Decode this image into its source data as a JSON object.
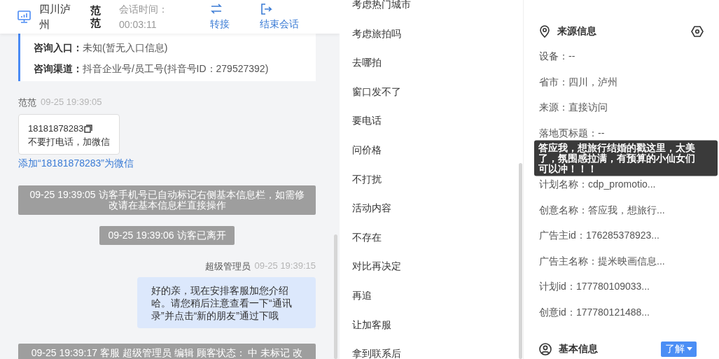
{
  "header": {
    "location": "四川泸州",
    "agent": "范范",
    "duration_label": "会话时间：",
    "duration": "00:03:11",
    "actions": [
      {
        "kind": "transfer",
        "label": "转接"
      },
      {
        "kind": "end",
        "label": "结束会话"
      }
    ]
  },
  "inquiry": [
    {
      "label": "咨询入口：",
      "value": "未知(暂无入口信息)"
    },
    {
      "label": "咨询渠道：",
      "value": "抖音企业号/员工号(抖音号ID：279527392)"
    }
  ],
  "messages": [
    {
      "kind": "visitor",
      "sender": "范范",
      "time": "09-25 19:39:05",
      "phone": "18181878283",
      "text": "不要打电话，加微信",
      "link": "添加“18181878283”为微信"
    },
    {
      "kind": "notice",
      "text": "09-25 19:39:05 访客手机号已自动标记右侧基本信息栏，如需修改请在基本信息栏直接操作"
    },
    {
      "kind": "notice",
      "text": "09-25 19:39:06 访客已离开"
    },
    {
      "kind": "agent",
      "sender": "超级管理员",
      "time": "09-25 19:39:15",
      "text": "好的亲，现在安排客服加您介绍哈。请您稍后注意查看一下“通讯录”并点击“新的朋友”通过下哦"
    },
    {
      "kind": "notice",
      "text": "09-25 19:39:17 客服 超级管理员 编辑 顾客状态： 中 未标记 改"
    }
  ],
  "quick_replies": [
    "考虑热门城市",
    "考虑旅拍吗",
    "去哪拍",
    "窗口发不了",
    "要电话",
    "问价格",
    "不打扰",
    "活动内容",
    "不存在",
    "对比再决定",
    "再追",
    "让加客服",
    "拿到联系后"
  ],
  "source_info": {
    "title": "来源信息",
    "rows": [
      {
        "kind": "row",
        "text": "设备：--"
      },
      {
        "kind": "row",
        "text": "省市：四川，泸州"
      },
      {
        "kind": "row",
        "text": "来源：直接访问"
      },
      {
        "kind": "row",
        "text": "落地页标题：--"
      },
      {
        "kind": "tooltip",
        "text": "答应我，想旅行结婚的戳这里，太美了，氛围感拉满，有预算的小仙女们可以冲！！！"
      },
      {
        "kind": "row",
        "text": "计划名称：cdp_promotio..."
      },
      {
        "kind": "row",
        "text": "创意名称：答应我，想旅行..."
      },
      {
        "kind": "row",
        "text": "广告主id：176285378923..."
      },
      {
        "kind": "row",
        "text": "广告主名称：提米映画信息..."
      },
      {
        "kind": "row",
        "text": "计划id：177780109033..."
      },
      {
        "kind": "row",
        "text": "创意id：177780121488..."
      }
    ]
  },
  "basic_info": {
    "title": "基本信息",
    "button": "了解"
  }
}
